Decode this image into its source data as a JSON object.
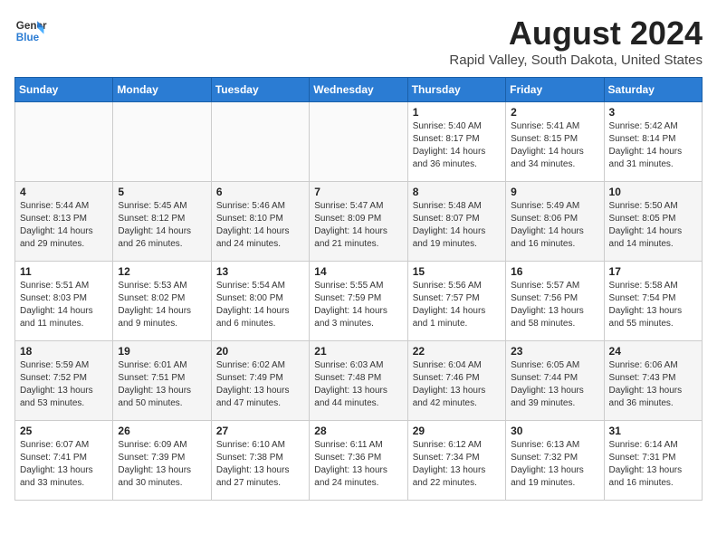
{
  "header": {
    "logo_line1": "General",
    "logo_line2": "Blue",
    "month_year": "August 2024",
    "location": "Rapid Valley, South Dakota, United States"
  },
  "weekdays": [
    "Sunday",
    "Monday",
    "Tuesday",
    "Wednesday",
    "Thursday",
    "Friday",
    "Saturday"
  ],
  "weeks": [
    [
      {
        "day": "",
        "info": ""
      },
      {
        "day": "",
        "info": ""
      },
      {
        "day": "",
        "info": ""
      },
      {
        "day": "",
        "info": ""
      },
      {
        "day": "1",
        "info": "Sunrise: 5:40 AM\nSunset: 8:17 PM\nDaylight: 14 hours\nand 36 minutes."
      },
      {
        "day": "2",
        "info": "Sunrise: 5:41 AM\nSunset: 8:15 PM\nDaylight: 14 hours\nand 34 minutes."
      },
      {
        "day": "3",
        "info": "Sunrise: 5:42 AM\nSunset: 8:14 PM\nDaylight: 14 hours\nand 31 minutes."
      }
    ],
    [
      {
        "day": "4",
        "info": "Sunrise: 5:44 AM\nSunset: 8:13 PM\nDaylight: 14 hours\nand 29 minutes."
      },
      {
        "day": "5",
        "info": "Sunrise: 5:45 AM\nSunset: 8:12 PM\nDaylight: 14 hours\nand 26 minutes."
      },
      {
        "day": "6",
        "info": "Sunrise: 5:46 AM\nSunset: 8:10 PM\nDaylight: 14 hours\nand 24 minutes."
      },
      {
        "day": "7",
        "info": "Sunrise: 5:47 AM\nSunset: 8:09 PM\nDaylight: 14 hours\nand 21 minutes."
      },
      {
        "day": "8",
        "info": "Sunrise: 5:48 AM\nSunset: 8:07 PM\nDaylight: 14 hours\nand 19 minutes."
      },
      {
        "day": "9",
        "info": "Sunrise: 5:49 AM\nSunset: 8:06 PM\nDaylight: 14 hours\nand 16 minutes."
      },
      {
        "day": "10",
        "info": "Sunrise: 5:50 AM\nSunset: 8:05 PM\nDaylight: 14 hours\nand 14 minutes."
      }
    ],
    [
      {
        "day": "11",
        "info": "Sunrise: 5:51 AM\nSunset: 8:03 PM\nDaylight: 14 hours\nand 11 minutes."
      },
      {
        "day": "12",
        "info": "Sunrise: 5:53 AM\nSunset: 8:02 PM\nDaylight: 14 hours\nand 9 minutes."
      },
      {
        "day": "13",
        "info": "Sunrise: 5:54 AM\nSunset: 8:00 PM\nDaylight: 14 hours\nand 6 minutes."
      },
      {
        "day": "14",
        "info": "Sunrise: 5:55 AM\nSunset: 7:59 PM\nDaylight: 14 hours\nand 3 minutes."
      },
      {
        "day": "15",
        "info": "Sunrise: 5:56 AM\nSunset: 7:57 PM\nDaylight: 14 hours\nand 1 minute."
      },
      {
        "day": "16",
        "info": "Sunrise: 5:57 AM\nSunset: 7:56 PM\nDaylight: 13 hours\nand 58 minutes."
      },
      {
        "day": "17",
        "info": "Sunrise: 5:58 AM\nSunset: 7:54 PM\nDaylight: 13 hours\nand 55 minutes."
      }
    ],
    [
      {
        "day": "18",
        "info": "Sunrise: 5:59 AM\nSunset: 7:52 PM\nDaylight: 13 hours\nand 53 minutes."
      },
      {
        "day": "19",
        "info": "Sunrise: 6:01 AM\nSunset: 7:51 PM\nDaylight: 13 hours\nand 50 minutes."
      },
      {
        "day": "20",
        "info": "Sunrise: 6:02 AM\nSunset: 7:49 PM\nDaylight: 13 hours\nand 47 minutes."
      },
      {
        "day": "21",
        "info": "Sunrise: 6:03 AM\nSunset: 7:48 PM\nDaylight: 13 hours\nand 44 minutes."
      },
      {
        "day": "22",
        "info": "Sunrise: 6:04 AM\nSunset: 7:46 PM\nDaylight: 13 hours\nand 42 minutes."
      },
      {
        "day": "23",
        "info": "Sunrise: 6:05 AM\nSunset: 7:44 PM\nDaylight: 13 hours\nand 39 minutes."
      },
      {
        "day": "24",
        "info": "Sunrise: 6:06 AM\nSunset: 7:43 PM\nDaylight: 13 hours\nand 36 minutes."
      }
    ],
    [
      {
        "day": "25",
        "info": "Sunrise: 6:07 AM\nSunset: 7:41 PM\nDaylight: 13 hours\nand 33 minutes."
      },
      {
        "day": "26",
        "info": "Sunrise: 6:09 AM\nSunset: 7:39 PM\nDaylight: 13 hours\nand 30 minutes."
      },
      {
        "day": "27",
        "info": "Sunrise: 6:10 AM\nSunset: 7:38 PM\nDaylight: 13 hours\nand 27 minutes."
      },
      {
        "day": "28",
        "info": "Sunrise: 6:11 AM\nSunset: 7:36 PM\nDaylight: 13 hours\nand 24 minutes."
      },
      {
        "day": "29",
        "info": "Sunrise: 6:12 AM\nSunset: 7:34 PM\nDaylight: 13 hours\nand 22 minutes."
      },
      {
        "day": "30",
        "info": "Sunrise: 6:13 AM\nSunset: 7:32 PM\nDaylight: 13 hours\nand 19 minutes."
      },
      {
        "day": "31",
        "info": "Sunrise: 6:14 AM\nSunset: 7:31 PM\nDaylight: 13 hours\nand 16 minutes."
      }
    ]
  ]
}
